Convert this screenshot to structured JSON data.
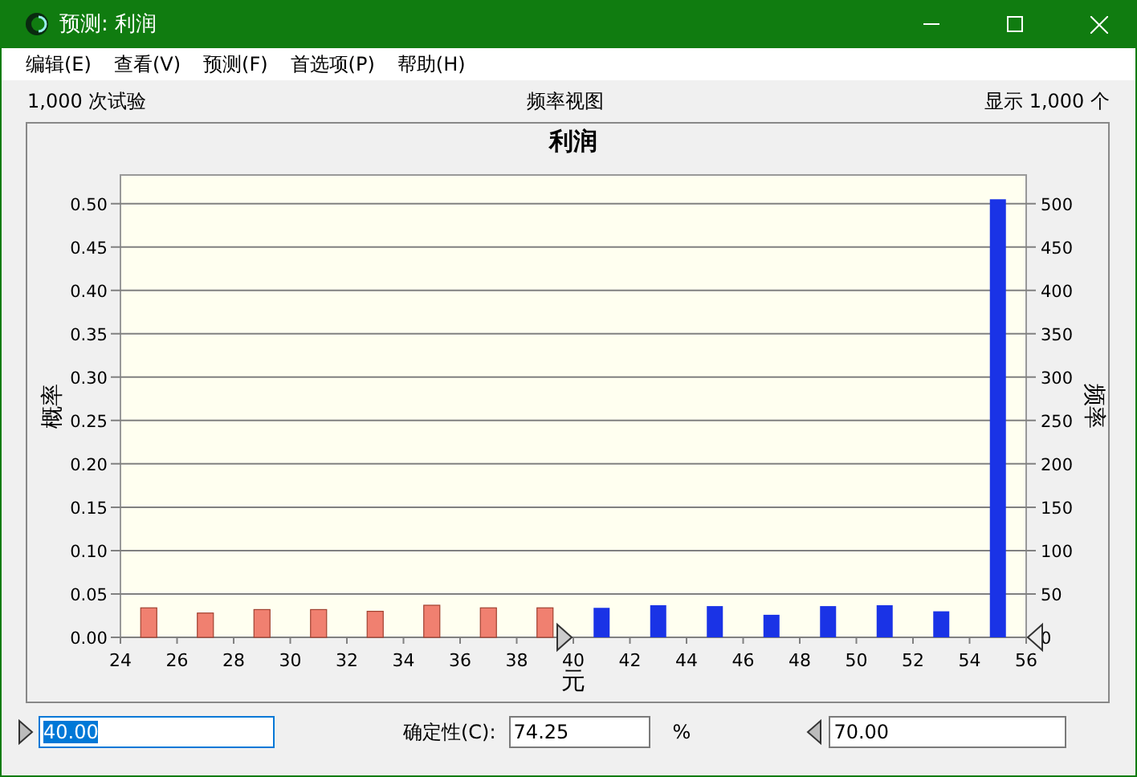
{
  "window": {
    "title": "预测: 利润"
  },
  "menu": [
    "编辑(E)",
    "查看(V)",
    "预测(F)",
    "首选项(P)",
    "帮助(H)"
  ],
  "info": {
    "trials": "1,000 次试验",
    "view": "频率视图",
    "shown": "显示 1,000 个"
  },
  "chart_data": {
    "type": "bar",
    "title": "利润",
    "xlabel": "元",
    "ylabel": "概率",
    "grid": true,
    "x": [
      25,
      27,
      29,
      31,
      33,
      35,
      37,
      39,
      41,
      43,
      45,
      47,
      49,
      51,
      53,
      55
    ],
    "series": [
      {
        "color": "#f08070",
        "values": [
          0.034,
          0.028,
          0.032,
          0.032,
          0.03,
          0.037,
          0.034,
          0.034,
          null,
          null,
          null,
          null,
          null,
          null,
          null,
          null
        ]
      },
      {
        "color": "#1a33e6",
        "values": [
          null,
          null,
          null,
          null,
          null,
          null,
          null,
          null,
          0.034,
          0.037,
          0.036,
          0.026,
          0.036,
          0.037,
          0.03,
          0.505
        ]
      }
    ],
    "xlim": [
      24,
      56
    ],
    "ylim": [
      0,
      0.533
    ],
    "xticks": [
      24,
      26,
      28,
      30,
      32,
      34,
      36,
      38,
      40,
      42,
      44,
      46,
      48,
      50,
      52,
      54,
      56
    ],
    "yticks": [
      {
        "value": 0,
        "label": "0.00"
      },
      {
        "value": 0.05,
        "label": "0.05"
      },
      {
        "value": 0.1,
        "label": "0.10"
      },
      {
        "value": 0.15,
        "label": "0.15"
      },
      {
        "value": 0.2,
        "label": "0.20"
      },
      {
        "value": 0.25,
        "label": "0.25"
      },
      {
        "value": 0.3,
        "label": "0.30"
      },
      {
        "value": 0.35,
        "label": "0.35"
      },
      {
        "value": 0.4,
        "label": "0.40"
      },
      {
        "value": 0.45,
        "label": "0.45"
      },
      {
        "value": 0.5,
        "label": "0.50"
      }
    ]
  },
  "right_axis": {
    "label": "频率",
    "ticks": [
      "500",
      "450",
      "400",
      "350",
      "300",
      "250",
      "200",
      "150",
      "100",
      "50",
      "0"
    ]
  },
  "bottom": {
    "lower": "40.00",
    "certainty_label": "确定性(C):",
    "certainty": "74.25",
    "unit": "%",
    "upper": "70.00"
  }
}
